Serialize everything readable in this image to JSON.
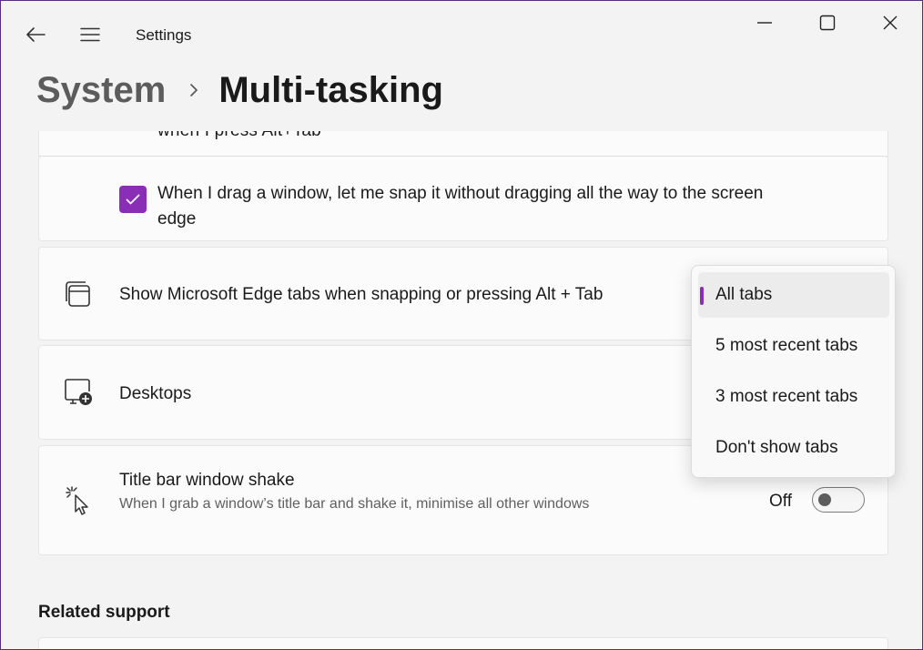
{
  "app": {
    "title": "Settings"
  },
  "breadcrumb": {
    "parent": "System",
    "current": "Multi-tasking"
  },
  "rows": {
    "partial_text": "when I press Alt+Tab",
    "snap_drag": {
      "label": "When I drag a window, let me snap it without dragging all the way to the screen edge",
      "checked": true
    },
    "edge_tabs": {
      "label": "Show Microsoft Edge tabs when snapping or pressing Alt + Tab",
      "icon": "edge-tabs-icon"
    },
    "desktops": {
      "label": "Desktops",
      "icon": "desktop-add-icon"
    },
    "shake": {
      "label": "Title bar window shake",
      "sub": "When I grab a window’s title bar and shake it, minimise all other windows",
      "state": "Off",
      "icon": "cursor-shake-icon"
    }
  },
  "related": {
    "title": "Related support"
  },
  "dropdown": {
    "options": [
      "All tabs",
      "5 most recent tabs",
      "3 most recent tabs",
      "Don't show tabs"
    ],
    "selected": "All tabs"
  },
  "colors": {
    "accent": "#8a2fb5",
    "background": "#f3f3f3",
    "card": "#fbfbfb"
  }
}
